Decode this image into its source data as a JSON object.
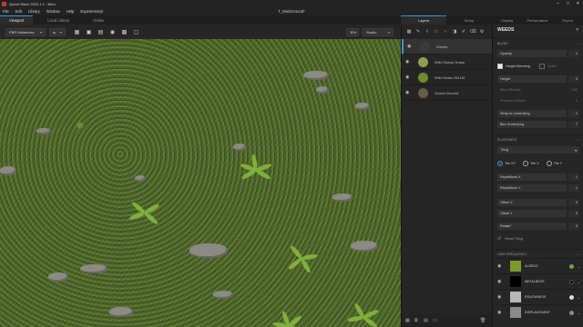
{
  "window": {
    "app_title": "Quixel Mixer 2022.1.1 - Beta",
    "controls": [
      "–",
      "□",
      "✕"
    ]
  },
  "menu": {
    "items": [
      "File",
      "Edit",
      "Library",
      "Window",
      "Help",
      "Experimental"
    ],
    "document_title": "T_MainGround*"
  },
  "viewport_tabs": [
    "Viewport",
    "Local Library",
    "Online"
  ],
  "viewport_toolbar": {
    "view_mode": "PBR Metalness",
    "dimension": "3D",
    "environment": "Studio"
  },
  "layers_tabs": [
    "Layers",
    "Setup"
  ],
  "props_tabs": [
    "Display",
    "Performance",
    "Export"
  ],
  "layers": [
    {
      "name": "Weeds",
      "selected": true,
      "thumb": "#3b3b3b"
    },
    {
      "name": "Wild Glossy Grass",
      "selected": false,
      "thumb": "#8aa04a"
    },
    {
      "name": "Wild Grass 2021M",
      "selected": false,
      "thumb": "#6e8f2e"
    },
    {
      "name": "Gravel Ground",
      "selected": false,
      "thumb": "#6a5a48"
    }
  ],
  "properties": {
    "title": "WEEDS",
    "blend": {
      "section": "BLEND",
      "opacity_label": "Opacity",
      "opacity": "1",
      "height_blending": "Height Blending",
      "invert": "Invert",
      "height_label": "Height",
      "height": "0",
      "blend_radius_label": "Blend Radius",
      "blend_radius": "0.50",
      "preserve_details": "Preserve Details",
      "preserve_value": "0",
      "wrap_label": "Wrap to Underlying",
      "wrap": "1",
      "blur_label": "Blur Underlying",
      "blur": "7"
    },
    "placement": {
      "section": "PLACEMENT",
      "mode": "Tiling",
      "tile_xy": "Tile XY",
      "tile_x": "Tile X",
      "tile_y": "Tile Y",
      "rep_x_label": "Repetitions X",
      "rep_x": "1",
      "rep_y_label": "Repetitions Y",
      "rep_y": "1",
      "offset_x_label": "Offset X",
      "offset_x": "0",
      "offset_y_label": "Offset Y",
      "offset_y": "0",
      "rotate_label": "Rotate°",
      "rotate": "0",
      "reset": "Reset Tiling"
    },
    "channels": {
      "section": "HIGH FREQUENCY",
      "items": [
        {
          "name": "ALBEDO",
          "swatch": "#7a9a2a",
          "dot": "#7fa12c"
        },
        {
          "name": "METALNESS",
          "swatch": "#000000",
          "dot": "#0a0a0a"
        },
        {
          "name": "ROUGHNESS",
          "swatch": "#b8b8b8",
          "dot": "#dcdcdc"
        },
        {
          "name": "DISPLACEMENT",
          "swatch": "#8a8a8a",
          "dot": "#8a8a8a"
        }
      ]
    }
  },
  "colors": {
    "accent": "#3a95d6",
    "panel": "#262626"
  }
}
